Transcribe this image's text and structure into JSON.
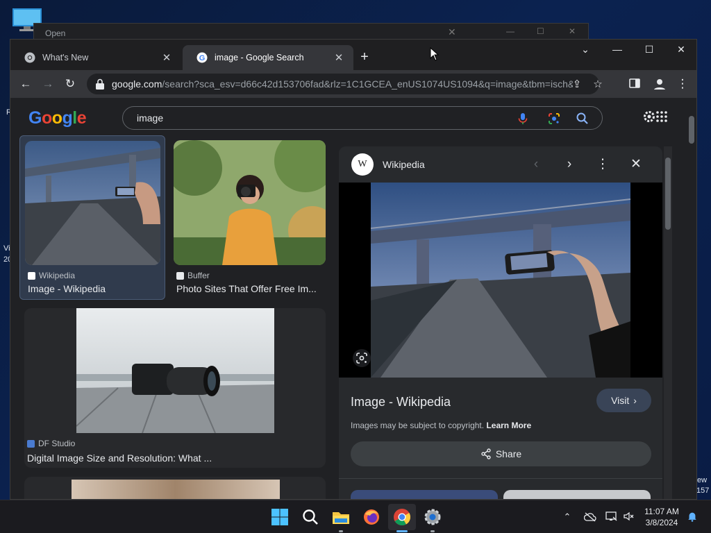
{
  "desktop": {
    "fragment_left_1": "R",
    "fragment_left_2": "Vi",
    "fragment_left_3": "20",
    "fragment_right_1": "ew",
    "fragment_right_2": "157"
  },
  "background_window": {
    "title": "Open"
  },
  "tabs": [
    {
      "label": "What's New",
      "active": false
    },
    {
      "label": "image - Google Search",
      "active": true
    }
  ],
  "address": {
    "domain": "google.com",
    "path": "/search?sca_esv=d66c42d153706fad&rlz=1C1GCEA_enUS1074US1094&q=image&tbm=isch&..."
  },
  "search": {
    "query": "image",
    "logo_text": "Google"
  },
  "results": [
    {
      "source": "Wikipedia",
      "title": "Image - Wikipedia",
      "selected": true
    },
    {
      "source": "Buffer",
      "title": "Photo Sites That Offer Free Im..."
    },
    {
      "source": "DF Studio",
      "title": "Digital Image Size and Resolution: What ..."
    }
  ],
  "panel": {
    "source": "Wikipedia",
    "logo_letter": "W",
    "title": "Image - Wikipedia",
    "visit_label": "Visit",
    "copyright_text": "Images may be subject to copyright.",
    "learn_more": "Learn More",
    "share_label": "Share"
  },
  "taskbar": {
    "time": "11:07 AM",
    "date": "3/8/2024"
  },
  "colors": {
    "accent": "#8ab4f8",
    "selected_card": "#303b4d",
    "visit_button": "#394457",
    "taskbar_indicator": "#5fb2ff"
  }
}
